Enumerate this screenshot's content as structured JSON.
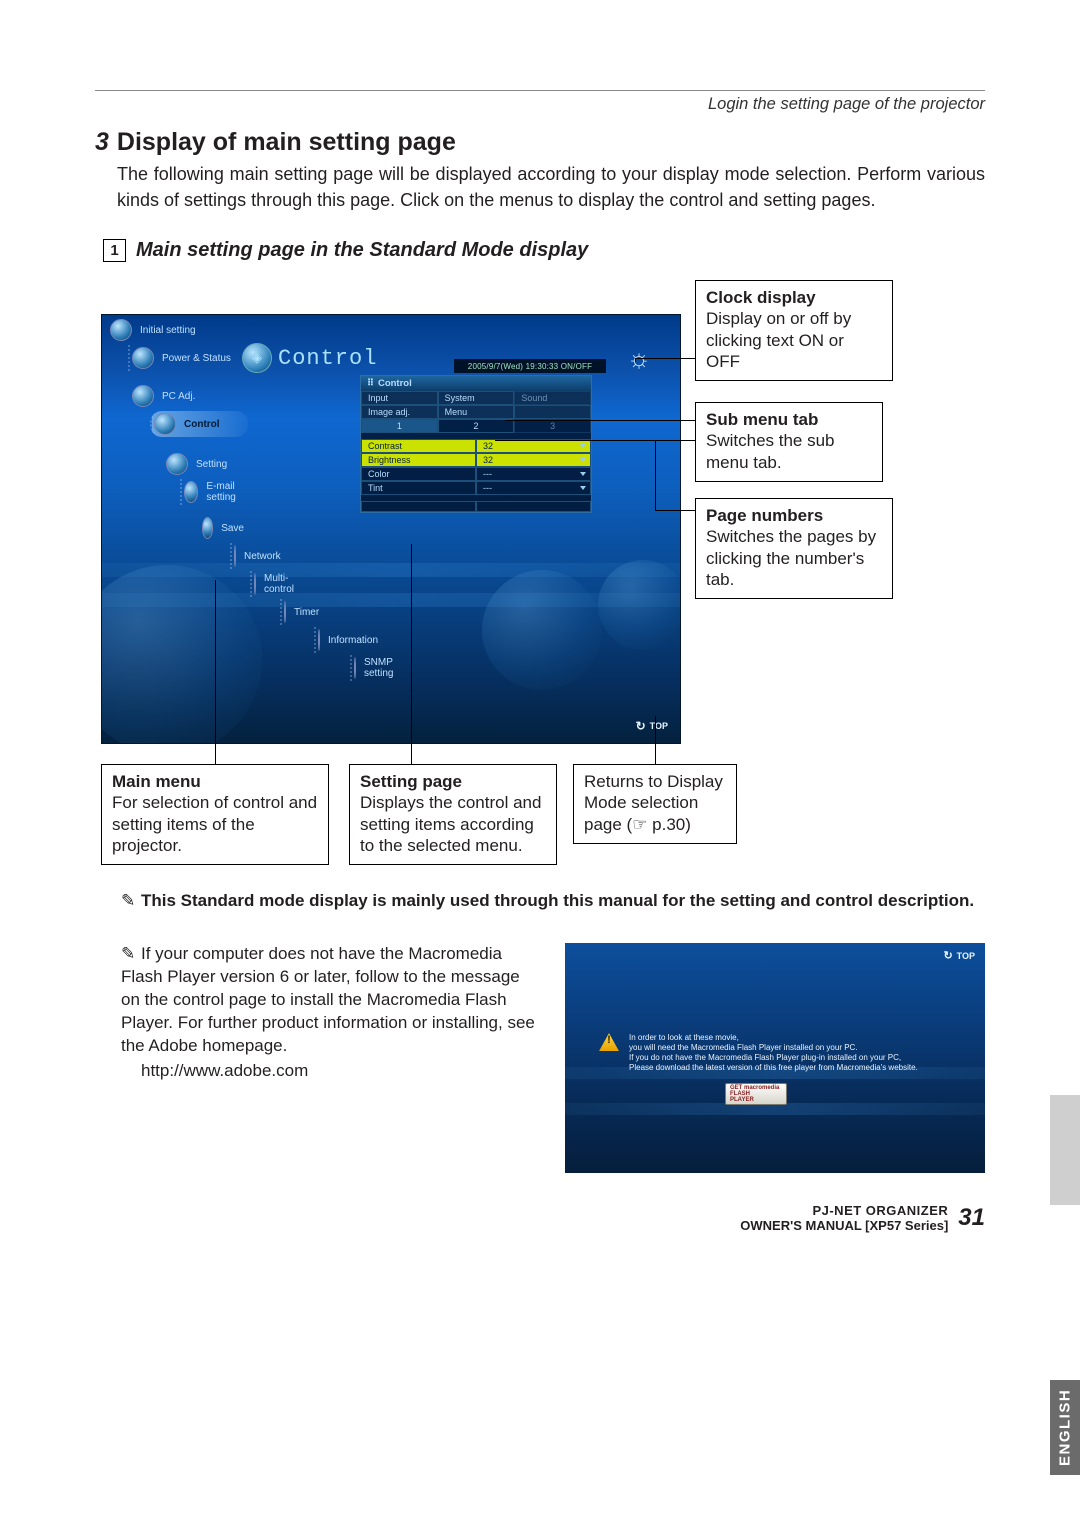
{
  "header_right": "Login the setting page of the projector",
  "section": {
    "num": "3",
    "title": "Display of main setting page"
  },
  "intro": "The following main setting page will be displayed according to your display mode selection. Perform various kinds of settings through this page. Click on the menus to display the control and setting pages.",
  "subsection": {
    "num": "1",
    "title": "Main setting page in the Standard Mode display"
  },
  "callouts": {
    "clock": {
      "title": "Clock display",
      "body": "Display on or off by clicking text ON or OFF"
    },
    "submenu": {
      "title": "Sub menu tab",
      "body": "Switches the sub menu tab."
    },
    "pagenum": {
      "title": "Page numbers",
      "body": "Switches the pages by clicking the number's tab."
    },
    "mainmenu": {
      "title": "Main menu",
      "body": "For selection of  control and setting items of the projector."
    },
    "setting": {
      "title": "Setting page",
      "body": "Displays the control and setting items according to the selected menu."
    },
    "return": {
      "body": "Returns to Display Mode selection page (☞ p.30)"
    }
  },
  "screenshot": {
    "header": "Control",
    "clockstrip": "2005/9/7(Wed)  19:30:33  ON/OFF",
    "nav": [
      "Initial setting",
      "Power & Status",
      "PC Adj.",
      "Control",
      "Setting",
      "E-mail setting",
      "Save",
      "Network",
      "Multi-control",
      "Timer",
      "Information",
      "SNMP setting"
    ],
    "panel_title": "Control",
    "row_input": "Input",
    "row_system": "System",
    "row_imageadj": "Image adj.",
    "row_sound": "Sound",
    "row_menu": "Menu",
    "pages": [
      "1",
      "2",
      "3"
    ],
    "contrast_label": "Contrast",
    "contrast_val": "32",
    "brightness_label": "Brightness",
    "brightness_val": "32",
    "color_label": "Color",
    "color_val": "---",
    "tint_label": "Tint",
    "tint_val": "---",
    "top_label": "TOP"
  },
  "note_main": "This Standard mode display is mainly used through this manual for the setting and control description.",
  "note_flash": "If your computer does not have the Macromedia Flash Player version 6 or later, follow to the message on the control page to install the Macromedia Flash Player. For further product information or installing, see the Adobe homepage.",
  "adobe_url": "http://www.adobe.com",
  "warn_lines": {
    "l1": "In order to look at these movie,",
    "l2": "you will need the Macromedia Flash Player installed on your PC.",
    "l3": "If you do not have the Macromedia Flash Player plug-in installed on your PC,",
    "l4": "Please download the latest version of this free player from Macromedia's website."
  },
  "flash_btn": {
    "l1": "GET macromedia",
    "l2": "FLASH",
    "l3": "PLAYER"
  },
  "side_tab_en": "ENGLISH",
  "footer": {
    "line1": "PJ-NET ORGANIZER",
    "line2": "OWNER'S MANUAL [XP57 Series]",
    "page": "31"
  }
}
